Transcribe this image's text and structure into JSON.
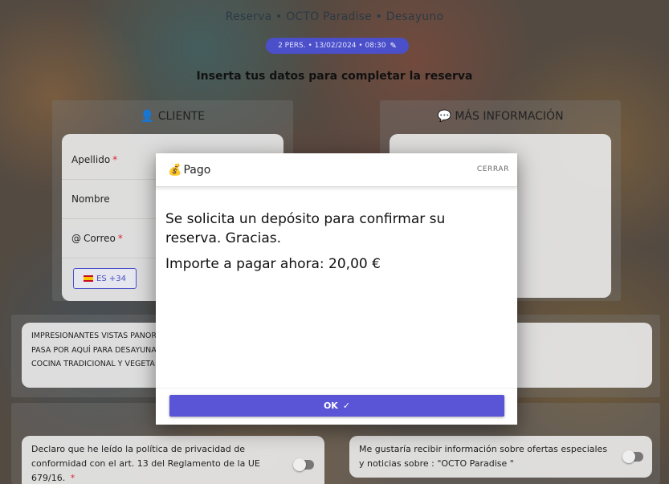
{
  "header": {
    "title": "Reserva • OCTO Paradise • Desayuno",
    "booking_badge": "2 PERS. • 13/02/2024 • 08:30",
    "subtitle": "Inserta tus datos para completar la reserva"
  },
  "cliente": {
    "title": "CLIENTE",
    "fields": {
      "apellido": "Apellido",
      "nombre": "Nombre",
      "correo": "Correo"
    },
    "required_mark": "*",
    "phone_prefix": "ES +34"
  },
  "mas_info": {
    "title": "MÁS INFORMACIÓN"
  },
  "description": {
    "line1": "IMPRESIONANTES VISTAS PANOR",
    "line2": "PASA POR AQUÍ PARA DESAYUNA",
    "line3": "COCINA TRADICIONAL Y VEGETA"
  },
  "consents": {
    "privacy": "Declaro que he leído la política de privacidad de conformidad con el art. 13 del Reglamento de la UE 679/16.",
    "offers": "Me gustaría recibir información sobre ofertas especiales y noticias sobre : \"OCTO Paradise \""
  },
  "modal": {
    "title": "Pago",
    "close_label": "CERRAR",
    "message": "Se solicita un depósito para confirmar su reserva. Gracias.",
    "amount": "Importe a pagar ahora: 20,00 €",
    "ok_label": "OK"
  },
  "colors": {
    "accent": "#5a55d6",
    "required": "#d22233"
  },
  "icons": [
    "user-icon",
    "chat-icon",
    "edit-icon",
    "money-bag-icon",
    "check-icon",
    "flag-es-icon"
  ]
}
